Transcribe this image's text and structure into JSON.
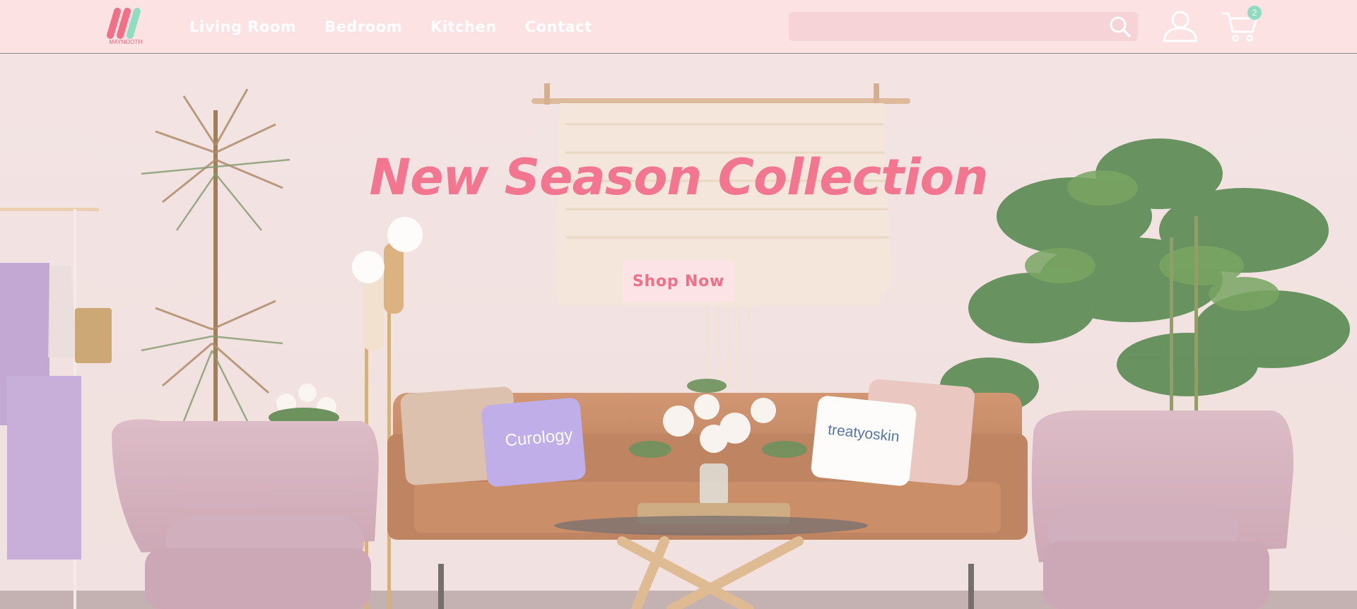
{
  "brand": {
    "logo_text": "MAYNOOTH"
  },
  "nav": {
    "items": [
      {
        "label": "Living Room"
      },
      {
        "label": "Bedroom"
      },
      {
        "label": "Kitchen"
      },
      {
        "label": "Contact"
      }
    ]
  },
  "search": {
    "placeholder": "",
    "value": ""
  },
  "cart": {
    "count": "2"
  },
  "icons": {
    "search": "search-icon",
    "account": "user-icon",
    "cart": "cart-icon"
  },
  "hero": {
    "title": "New Season Collection",
    "button_label": "Shop Now"
  },
  "colors": {
    "header_bg": "#fde2e4",
    "accent_pink": "#f37690",
    "accent_mint": "#8fdcc0",
    "button_bg": "#fce3e6"
  }
}
